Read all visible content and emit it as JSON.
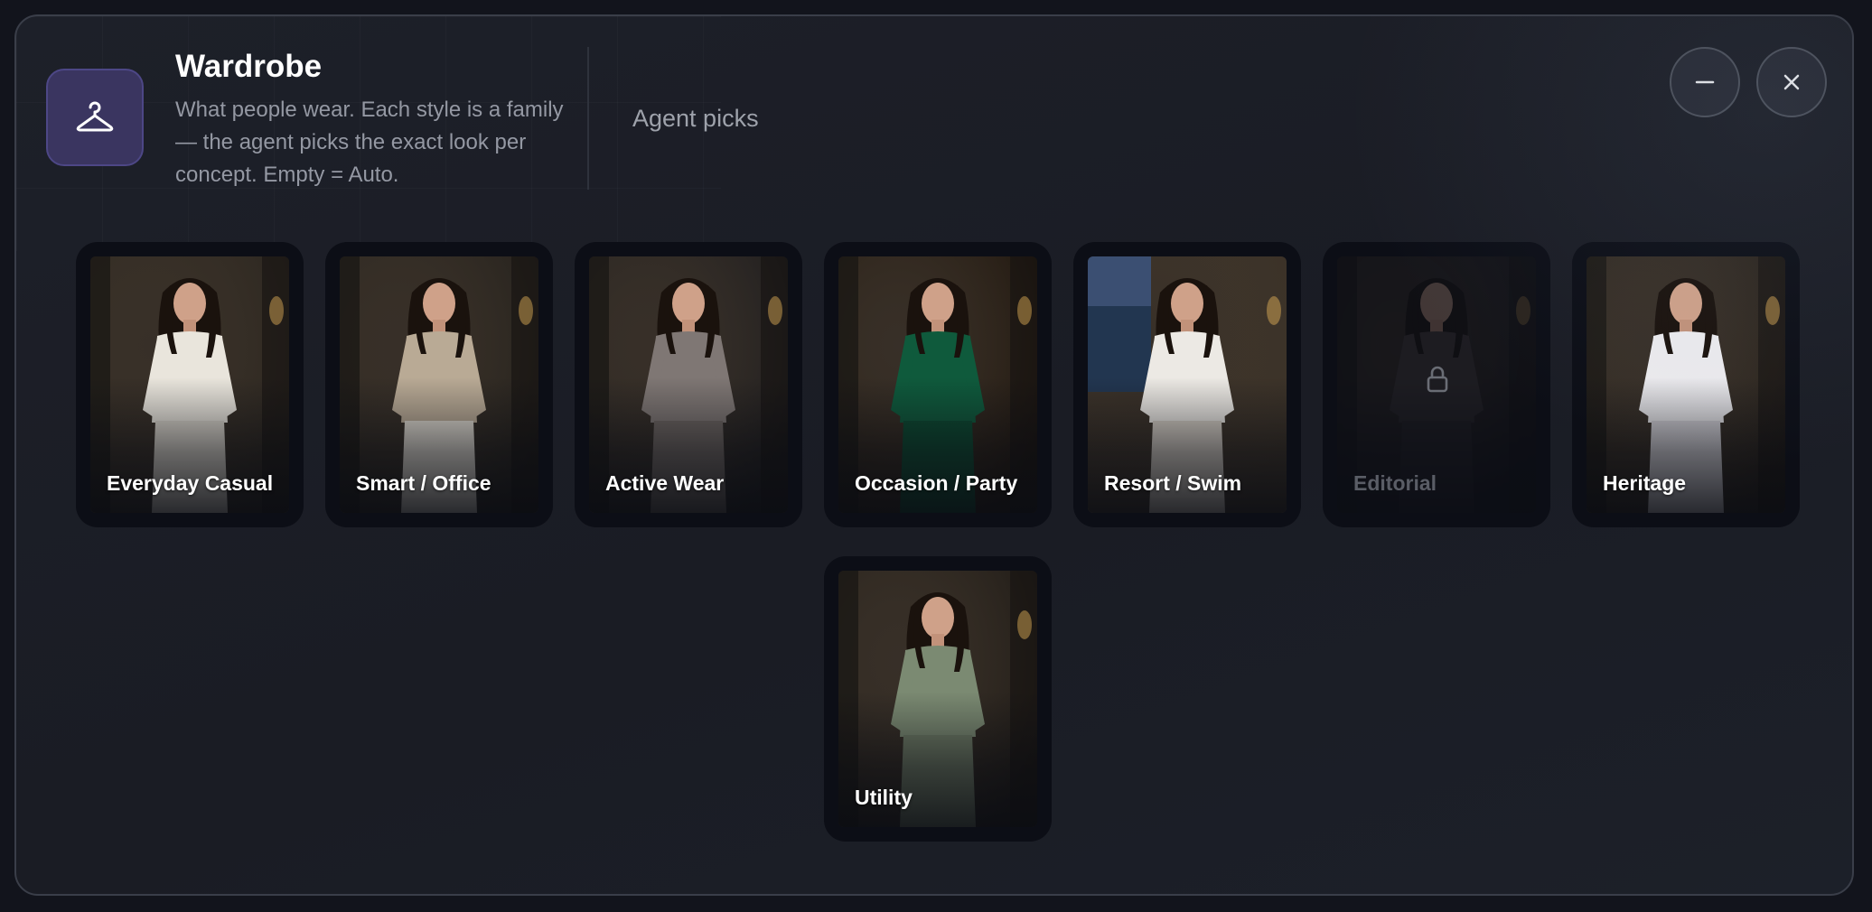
{
  "header": {
    "title": "Wardrobe",
    "description": "What people wear. Each style is a family — the agent picks the exact look per concept. Empty = Auto.",
    "selection": "Agent picks",
    "category_icon": "hanger-icon"
  },
  "window_controls": {
    "minimize_icon": "minus-icon",
    "close_icon": "close-icon"
  },
  "styles": [
    {
      "label": "Everyday Casual",
      "outfit": "#e9e5dc",
      "pants": "#dcd7cd",
      "bg": "#2b2620",
      "locked": false
    },
    {
      "label": "Smart / Office",
      "outfit": "#b9aa95",
      "pants": "#e1dcd2",
      "bg": "#24211d",
      "locked": false
    },
    {
      "label": "Active Wear",
      "outfit": "#7f7774",
      "pants": "#6e6662",
      "bg": "#1e1d1f",
      "locked": false
    },
    {
      "label": "Occasion / Party",
      "outfit": "#0f5a3c",
      "pants": "#0c4a31",
      "bg": "#20170f",
      "locked": false
    },
    {
      "label": "Resort / Swim",
      "outfit": "#ece9e4",
      "pants": "#d8d1c7",
      "bg": "#3b3228",
      "locked": false
    },
    {
      "label": "Editorial",
      "outfit": "#4a4340",
      "pants": "#3d3735",
      "bg": "#1b1a1a",
      "locked": true
    },
    {
      "label": "Heritage",
      "outfit": "#ecebee",
      "pants": "#d7d5da",
      "bg": "#27211b",
      "locked": false
    },
    {
      "label": "Utility",
      "outfit": "#7b8a72",
      "pants": "#6f7c66",
      "bg": "#1f1b17",
      "locked": false
    }
  ],
  "colors": {
    "accent": "#4d4786",
    "panel_border": "#3a3e49",
    "card_bg": "#0c0e16"
  }
}
